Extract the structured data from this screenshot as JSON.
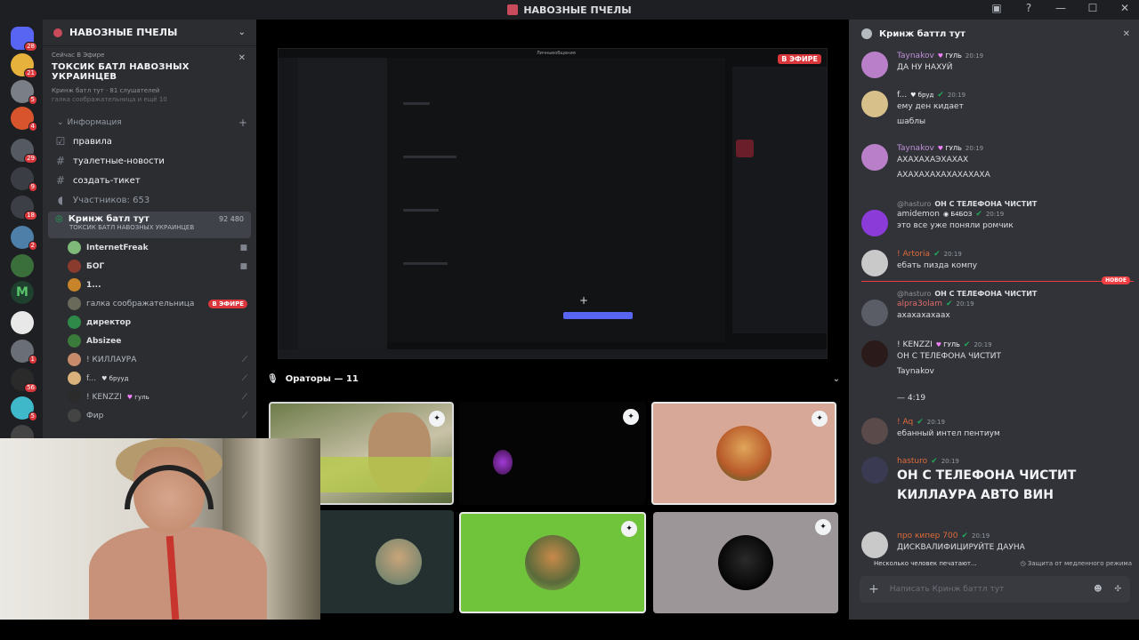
{
  "window": {
    "title": "НАВОЗНЫЕ ПЧЕЛЫ"
  },
  "rail": {
    "badges": [
      "28",
      "21",
      "5",
      "4",
      "29",
      "9",
      "18",
      "2",
      "1",
      "56",
      "5"
    ]
  },
  "sidebar": {
    "server_name": "НАВОЗНЫЕ ПЧЕЛЫ",
    "live": {
      "label": "Сейчас В Эфире",
      "title": "ТОКСИК БАТЛ НАВОЗНЫХ УКРАИНЦЕВ",
      "sub": "Кринж батл тут · 81 слушателей",
      "sub2": "галка соображательница и ещё 10"
    },
    "category": "Информация",
    "channels": [
      {
        "icon": "rules-icon",
        "label": "правила"
      },
      {
        "icon": "hash-icon",
        "label": "туалетные-новости"
      },
      {
        "icon": "hash-icon",
        "label": "создать-тикет"
      },
      {
        "icon": "speaker-icon",
        "label": "Участников: 653"
      }
    ],
    "voice_channel": {
      "name": "Кринж батл тут",
      "counts": "92   480",
      "topic": "ТОКСИК БАТЛ НАВОЗНЫХ УКРАИНЦЕВ"
    },
    "voice_users": [
      {
        "name": "InternetFreak",
        "color": "#7fb97a"
      },
      {
        "name": "БОГ",
        "color": "#8a3b2e"
      },
      {
        "name": "1...",
        "color": "#c7842b"
      },
      {
        "name": "галка соображательница",
        "color": "#6a6a5a",
        "live": "В ЭФИРЕ"
      },
      {
        "name": "директор",
        "color": "#2f8a4a"
      },
      {
        "name": "Absizee",
        "color": "#3a7a3a"
      },
      {
        "name": "! КИЛЛАУРА",
        "color": "#c78a6a"
      },
      {
        "name": "f...",
        "tag": "брууд",
        "color": "#d8b27a"
      },
      {
        "name": "! KENZZI",
        "tag": "гуль",
        "color": "#2b2b2b"
      },
      {
        "name": "Фир",
        "color": "#444"
      }
    ]
  },
  "stream": {
    "inner_title": "Личныеобщения",
    "live_label": "В ЭФИРЕ"
  },
  "speakers": {
    "label": "Ораторы — 11"
  },
  "chat": {
    "channel": "Кринж баттл тут",
    "messages": [
      {
        "user": "Taynakov",
        "tag": "ГУЛЬ",
        "time": "20:19",
        "lines": [
          "ДА НУ НАХУЙ"
        ]
      },
      {
        "user": "f...",
        "tag": "бруд",
        "time": "20:19",
        "lines": [
          "ему ден кидает",
          "шаблы"
        ]
      },
      {
        "user": "Taynakov",
        "tag": "ГУЛЬ",
        "time": "20:19",
        "lines": [
          "АХАХАХАЭХАХАХ",
          "АХАХАХАХАХАХАХАХА"
        ]
      },
      {
        "reply_name": "@hasturo",
        "reply_text": "ОН С ТЕЛЕФОНА ЧИСТИТ",
        "user": "amidemon",
        "tag": "Б4БОЗ",
        "time": "20:19",
        "lines": [
          "это все уже поняли ромчик"
        ]
      },
      {
        "user": "! Artoria",
        "time": "20:19",
        "lines": [
          "ебать пизда компу"
        ]
      },
      {
        "reply_name": "@hasturo",
        "reply_text": "ОН С ТЕЛЕФОНА ЧИСТИТ",
        "user": "alpra3olam",
        "time": "20:19",
        "lines": [
          "ахахахахаах"
        ]
      },
      {
        "user": "! KENZZI",
        "tag": "ГУЛЬ",
        "time": "20:19",
        "lines": [
          "ОН С ТЕЛЕФОНА ЧИСТИТ",
          "Taynakov"
        ]
      },
      {
        "user": "",
        "time": "",
        "lines": [
          "— 4:19"
        ]
      },
      {
        "user": "! Aq",
        "time": "20:19",
        "lines": [
          "ебанный интел пентиум"
        ]
      },
      {
        "user": "hasturo",
        "time": "20:19",
        "big": [
          "ОН С ТЕЛЕФОНА ЧИСТИТ",
          "КИЛЛАУРА АВТО ВИН"
        ]
      },
      {
        "user": "про кипер 700",
        "time": "20:19",
        "lines": [
          "ДИСКВАЛИФИЦИРУЙТЕ ДАУНА"
        ]
      }
    ],
    "new_label": "НОВОЕ",
    "typing": "Несколько человек печатают...",
    "slowmode": "Защита от медленного режима",
    "input_placeholder": "Написать Кринж баттл тут"
  }
}
